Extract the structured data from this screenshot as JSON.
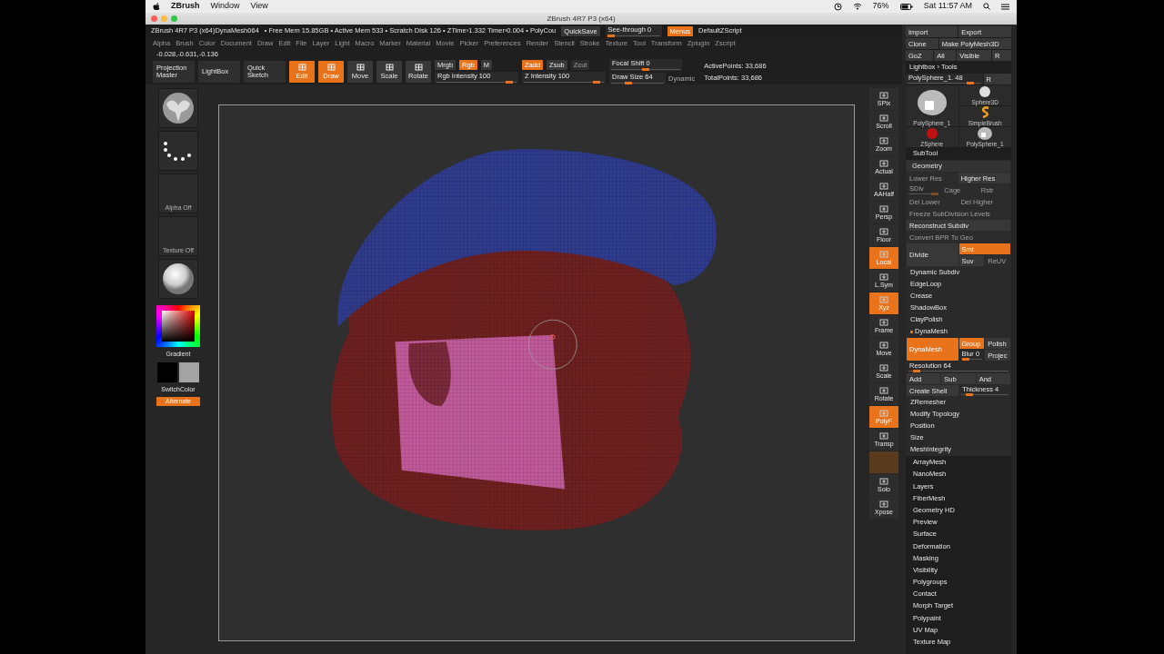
{
  "mac_menubar": {
    "app": "ZBrush",
    "menus": [
      "Window",
      "View"
    ],
    "battery": "76%",
    "clock": "Sat 11:57 AM"
  },
  "window": {
    "title": "ZBrush 4R7 P3 (x64)"
  },
  "info_bar": {
    "document": "ZBrush 4R7 P3 (x64)DynaMesh064",
    "stats": "• Free Mem 15.85GB • Active Mem 533 • Scratch Disk 126 • ZTime›1.332 Timer›0.004 • PolyCou",
    "quicksave": "QuickSave",
    "see_through": {
      "label": "See-through  0",
      "level": 0
    },
    "menus_toggle": {
      "label": "Menus",
      "on": true
    },
    "script": "DefaultZScript"
  },
  "menu_bar": [
    "Alpha",
    "Brush",
    "Color",
    "Document",
    "Draw",
    "Edit",
    "File",
    "Layer",
    "Light",
    "Macro",
    "Marker",
    "Material",
    "Movie",
    "Picker",
    "Preferences",
    "Render",
    "Stencil",
    "Stroke",
    "Texture",
    "Tool",
    "Transform",
    "Zplugin",
    "Zscript"
  ],
  "coordinates": "-0.028,-0.631,-0.136",
  "toolbar": {
    "left_buttons": [
      {
        "label": "Projection Master"
      },
      {
        "label": "LightBox"
      },
      {
        "label": "Quick Sketch"
      }
    ],
    "modes": [
      {
        "label": "Edit",
        "on": true
      },
      {
        "label": "Draw",
        "on": true
      },
      {
        "label": "Move",
        "on": false
      },
      {
        "label": "Scale",
        "on": false
      },
      {
        "label": "Rotate",
        "on": false
      }
    ],
    "color_modes": [
      {
        "label": "Mrgb",
        "on": false
      },
      {
        "label": "Rgb",
        "on": true
      },
      {
        "label": "M",
        "on": false
      }
    ],
    "rgb_intensity": {
      "label": "Rgb Intensity 100",
      "level": 0.95
    },
    "z_modes": [
      {
        "label": "Zadd",
        "on": true,
        "disabled": false
      },
      {
        "label": "Zsub",
        "on": false,
        "disabled": false
      },
      {
        "label": "Zcut",
        "on": false,
        "disabled": true
      }
    ],
    "z_intensity": {
      "label": "Z Intensity 100",
      "level": 0.95
    },
    "focal_shift": {
      "label": "Focal Shift 0",
      "level": 0.5
    },
    "draw_size": {
      "label": "Draw Size 64",
      "level": 0.3
    },
    "dynamic": "Dynamic",
    "active_points": "ActivePoints: 33,686",
    "total_points": "TotalPoints: 33,686"
  },
  "left_shelf": {
    "thumbnails": [
      {
        "kind": "brush"
      },
      {
        "kind": "stroke"
      },
      {
        "kind": "alpha",
        "label": "Alpha Off"
      },
      {
        "kind": "texture",
        "label": "Texture Off"
      },
      {
        "kind": "material"
      }
    ],
    "gradient": "Gradient",
    "swatches": [
      {
        "color": "#000000"
      },
      {
        "color": "#a3a3a3"
      }
    ],
    "switch_color": "SwitchColor",
    "alternate": {
      "label": "Alternate",
      "on": true
    }
  },
  "right_shelf": [
    {
      "label": "SPix",
      "on": false,
      "disabled": false
    },
    {
      "label": "Scroll",
      "on": false,
      "disabled": false
    },
    {
      "label": "Zoom",
      "on": false,
      "disabled": false
    },
    {
      "label": "Actual",
      "on": false,
      "disabled": false
    },
    {
      "label": "AAHalf",
      "on": false,
      "disabled": false
    },
    {
      "label": "Persp",
      "on": false,
      "disabled": false
    },
    {
      "label": "Floor",
      "on": false,
      "disabled": false
    },
    {
      "label": "Local",
      "on": true,
      "disabled": false
    },
    {
      "label": "L.Sym",
      "on": false,
      "disabled": false
    },
    {
      "label": "Xyz",
      "on": true,
      "disabled": false
    },
    {
      "label": "Frame",
      "on": false,
      "disabled": false
    },
    {
      "label": "Move",
      "on": false,
      "disabled": false
    },
    {
      "label": "Scale",
      "on": false,
      "disabled": false
    },
    {
      "label": "Rotate",
      "on": false,
      "disabled": false
    },
    {
      "label": "PolyF",
      "on": true,
      "disabled": false
    },
    {
      "label": "Transp",
      "on": false,
      "disabled": false
    },
    {
      "on": false,
      "disabled": true
    },
    {
      "label": "Solo",
      "on": false,
      "disabled": false
    },
    {
      "label": "Xpose",
      "on": false,
      "disabled": false
    }
  ],
  "tool_palette": [
    {
      "kind": "buttons",
      "items": [
        {
          "label": "Import"
        },
        {
          "label": "Export"
        }
      ]
    },
    {
      "kind": "buttons",
      "items": [
        {
          "label": "Clone"
        },
        {
          "label": "Make PolyMesh3D"
        }
      ]
    },
    {
      "kind": "buttons",
      "items": [
        {
          "label": "GoZ"
        },
        {
          "label": "All"
        },
        {
          "label": "Visible"
        },
        {
          "label": "R"
        }
      ]
    },
    {
      "kind": "item",
      "label": "Lightbox › Tools"
    },
    {
      "kind": "buttons",
      "items": [
        {
          "label": "PolySphere_1. 48",
          "level": 0.9
        },
        {
          "label": "R"
        }
      ]
    },
    {
      "kind": "thumbs",
      "items": [
        {
          "kind": "head",
          "label": "PolySphere_1"
        },
        {
          "kind": "zsphere",
          "label": "ZSphere"
        },
        {
          "kind": "sphere",
          "label": "Sphere3D"
        },
        {
          "kind": "swirl",
          "label": "SimpleBrush"
        },
        {
          "kind": "head",
          "label": "PolySphere_1"
        }
      ]
    },
    {
      "kind": "section",
      "label": "SubTool"
    },
    {
      "kind": "group",
      "label": "Geometry",
      "rows": [
        {
          "kind": "buttons",
          "items": [
            {
              "label": "Lower Res",
              "disabled": true
            },
            {
              "label": "Higher Res",
              "disabled": false
            }
          ]
        },
        {
          "kind": "buttons",
          "items": [
            {
              "label": "SDiv",
              "level": 1,
              "disabled": true
            },
            {
              "label": "Cage",
              "disabled": true
            },
            {
              "label": "Rstr",
              "disabled": true
            }
          ]
        },
        {
          "kind": "buttons",
          "items": [
            {
              "label": "Del Lower",
              "disabled": true
            },
            {
              "label": "Del Higher",
              "disabled": true
            }
          ]
        },
        {
          "kind": "buttons",
          "items": [
            {
              "label": "Freeze SubDivision Levels",
              "disabled": true
            }
          ]
        },
        {
          "kind": "buttons",
          "items": [
            {
              "label": "Reconstruct Subdiv"
            }
          ]
        },
        {
          "kind": "buttons",
          "items": [
            {
              "label": "Convert BPR To Geo",
              "disabled": true
            }
          ]
        },
        {
          "kind": "split",
          "button": {
            "label": "Divide",
            "on": false
          },
          "option_rows": [
            {
              "items": [
                {
                  "label": "Smt",
                  "on": true
                }
              ]
            },
            {
              "items": [
                {
                  "label": "Suv",
                  "disabled": false
                },
                {
                  "label": "ReUV",
                  "disabled": true
                }
              ]
            }
          ]
        },
        {
          "kind": "item",
          "label": "Dynamic Subdiv"
        },
        {
          "kind": "item",
          "label": "EdgeLoop"
        },
        {
          "kind": "item",
          "label": "Crease"
        },
        {
          "kind": "item",
          "label": "ShadowBox"
        },
        {
          "kind": "item",
          "label": "ClayPolish"
        },
        {
          "kind": "active_item",
          "label": "DynaMesh"
        },
        {
          "kind": "split",
          "button": {
            "label": "DynaMesh",
            "on": true
          },
          "option_rows": [
            {
              "items": [
                {
                  "label": "Group",
                  "on": true
                },
                {
                  "label": "Polish",
                  "on": false
                }
              ]
            },
            {
              "items": [
                {
                  "label": "Blur 0",
                  "level": 0.12
                },
                {
                  "label": "Projec"
                }
              ]
            }
          ]
        },
        {
          "kind": "buttons",
          "items": [
            {
              "label": "Resolution 64",
              "level": 0.05
            }
          ]
        },
        {
          "kind": "buttons",
          "items": [
            {
              "label": "Add"
            },
            {
              "label": "Sub"
            },
            {
              "label": "And"
            }
          ]
        },
        {
          "kind": "buttons",
          "items": [
            {
              "label": "Create Shell"
            },
            {
              "label": "Thickness 4",
              "level": 0.1
            }
          ]
        },
        {
          "kind": "item",
          "label": "ZRemesher"
        },
        {
          "kind": "item",
          "label": "Modify Topology"
        },
        {
          "kind": "item",
          "label": "Position"
        },
        {
          "kind": "item",
          "label": "Size"
        },
        {
          "kind": "item",
          "label": "MeshIntegrity"
        }
      ]
    },
    {
      "kind": "section",
      "label": "ArrayMesh"
    },
    {
      "kind": "section",
      "label": "NanoMesh"
    },
    {
      "kind": "section",
      "label": "Layers"
    },
    {
      "kind": "section",
      "label": "FiberMesh"
    },
    {
      "kind": "section",
      "label": "Geometry HD"
    },
    {
      "kind": "section",
      "label": "Preview"
    },
    {
      "kind": "section",
      "label": "Surface"
    },
    {
      "kind": "section",
      "label": "Deformation"
    },
    {
      "kind": "section",
      "label": "Masking"
    },
    {
      "kind": "section",
      "label": "Visibility"
    },
    {
      "kind": "section",
      "label": "Polygroups"
    },
    {
      "kind": "section",
      "label": "Contact"
    },
    {
      "kind": "section",
      "label": "Morph Target"
    },
    {
      "kind": "section",
      "label": "Polypaint"
    },
    {
      "kind": "section",
      "label": "UV Map"
    },
    {
      "kind": "section",
      "label": "Texture Map"
    }
  ]
}
